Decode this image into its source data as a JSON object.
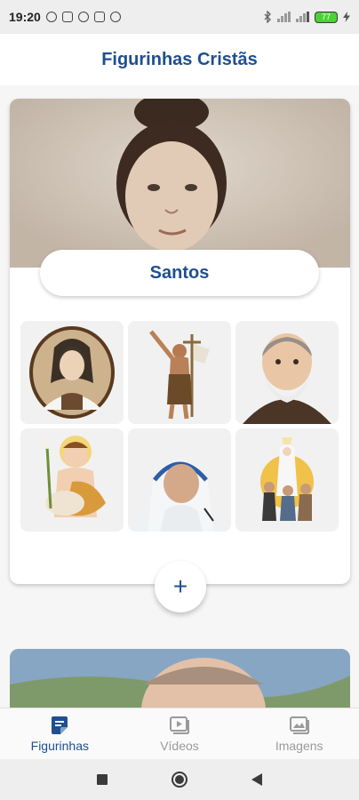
{
  "status_bar": {
    "time": "19:20",
    "battery": "77"
  },
  "app_bar": {
    "title": "Figurinhas Cristãs"
  },
  "section": {
    "label": "Santos",
    "add_symbol": "+"
  },
  "stickers": [
    {
      "icon": "saint-therese-sticker"
    },
    {
      "icon": "john-the-baptist-sticker"
    },
    {
      "icon": "padre-pio-sticker"
    },
    {
      "icon": "child-saint-lamb-sticker"
    },
    {
      "icon": "mother-teresa-sticker"
    },
    {
      "icon": "our-lady-of-fatima-sticker"
    }
  ],
  "bottom_nav": {
    "items": [
      {
        "label": "Figurinhas",
        "icon": "sticker-icon",
        "active": true
      },
      {
        "label": "Vídeos",
        "icon": "video-icon",
        "active": false
      },
      {
        "label": "Imagens",
        "icon": "image-icon",
        "active": false
      }
    ]
  },
  "colors": {
    "accent": "#1f4f8f",
    "inactive": "#9a9a9a"
  }
}
